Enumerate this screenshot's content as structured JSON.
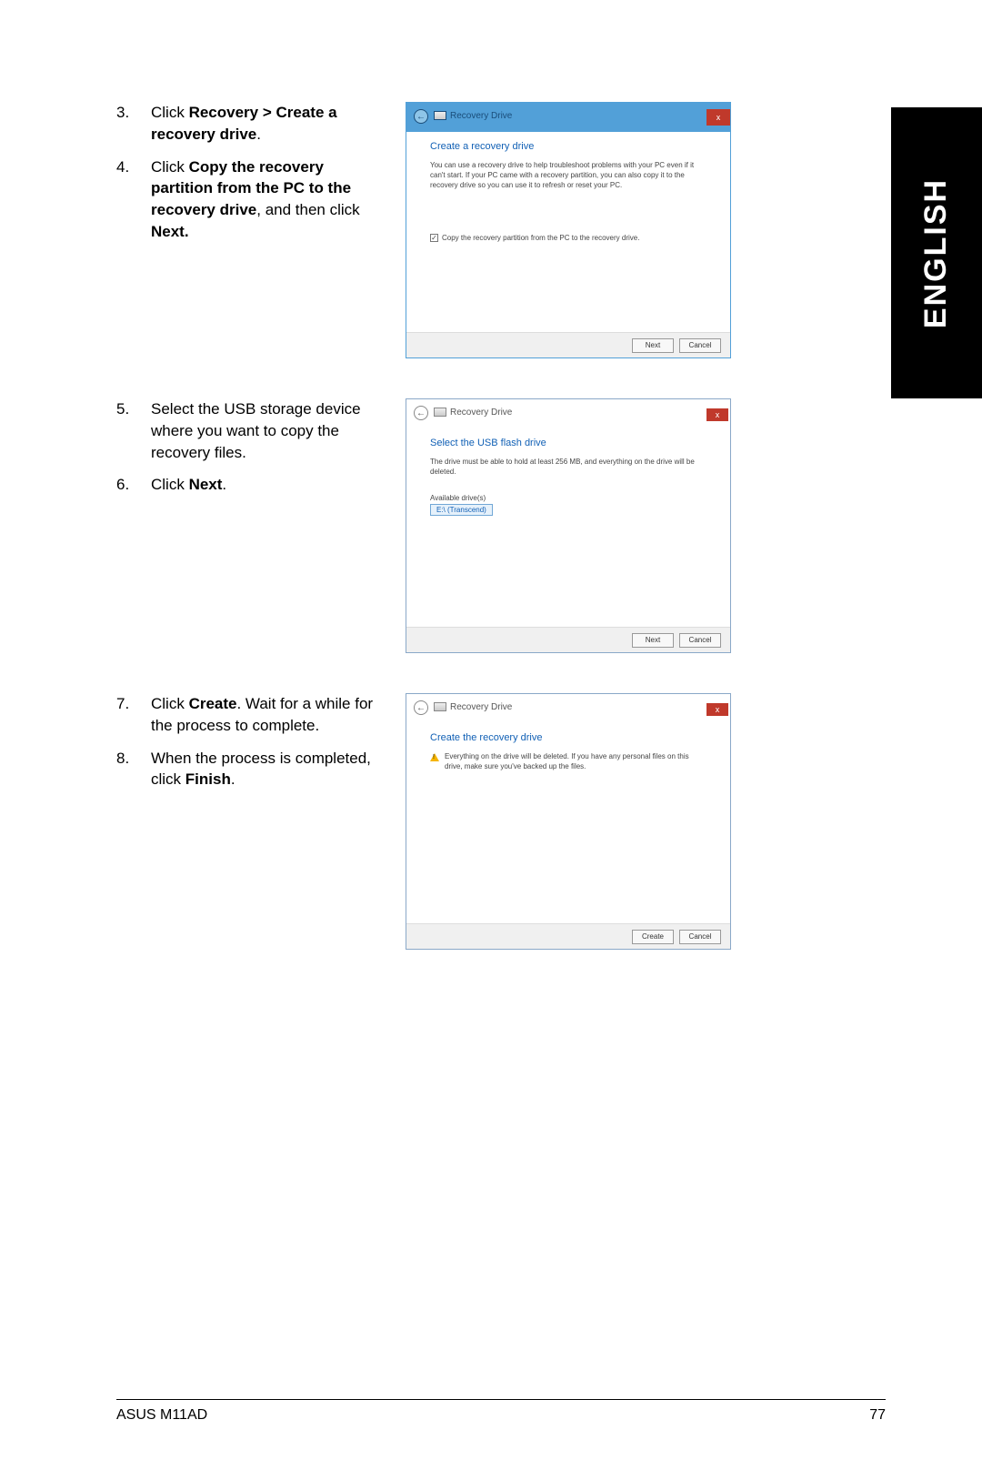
{
  "sideTab": "ENGLISH",
  "footer": {
    "left": "ASUS M11AD",
    "right": "77"
  },
  "steps": {
    "s3": {
      "num": "3.",
      "pre": "Click ",
      "bold1": "Recovery > Create a recovery drive",
      "post": "."
    },
    "s4": {
      "num": "4.",
      "pre": "Click ",
      "bold1": "Copy the recovery partition from the PC to the recovery drive",
      "mid": ", and then click ",
      "bold2": "Next.",
      "post": ""
    },
    "s5": {
      "num": "5.",
      "text": "Select the USB storage device where you want to copy the recovery files."
    },
    "s6": {
      "num": "6.",
      "pre": "Click ",
      "bold1": "Next",
      "post": "."
    },
    "s7": {
      "num": "7.",
      "pre": "Click ",
      "bold1": "Create",
      "mid": ". Wait for a while for the process to complete."
    },
    "s8": {
      "num": "8.",
      "pre": "When the process is completed, click ",
      "bold1": "Finish",
      "post": "."
    }
  },
  "win1": {
    "title": "Recovery Drive",
    "heading": "Create a recovery drive",
    "desc": "You can use a recovery drive to help troubleshoot problems with your PC even if it can't start. If your PC came with a recovery partition, you can also copy it to the recovery drive so you can use it to refresh or reset your PC.",
    "checkbox": "Copy the recovery partition from the PC to the recovery drive.",
    "next": "Next",
    "cancel": "Cancel"
  },
  "win2": {
    "title": "Recovery Drive",
    "heading": "Select the USB flash drive",
    "desc": "The drive must be able to hold at least 256 MB, and everything on the drive will be deleted.",
    "listLabel": "Available drive(s)",
    "listItem": "E:\\ (Transcend)",
    "next": "Next",
    "cancel": "Cancel"
  },
  "win3": {
    "title": "Recovery Drive",
    "heading": "Create the recovery drive",
    "warn": "Everything on the drive will be deleted. If you have any personal files on this drive, make sure you've backed up the files.",
    "create": "Create",
    "cancel": "Cancel"
  }
}
